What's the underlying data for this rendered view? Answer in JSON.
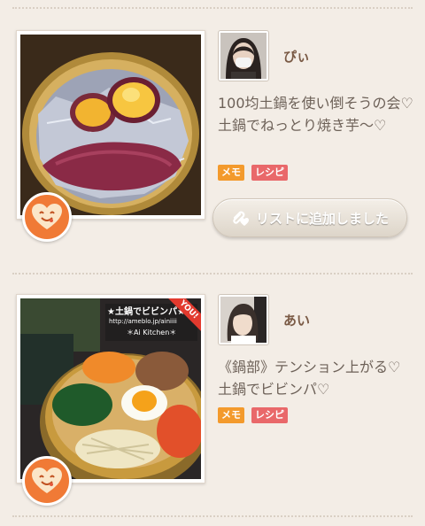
{
  "posts": [
    {
      "username": "ぴぃ",
      "title": "100均土鍋を使い倒そうの会♡土鍋でねっとり焼き芋〜♡",
      "tags": {
        "memo": "メモ",
        "recipe": "レシピ"
      },
      "list_button_label": "リストに追加しました",
      "photo_icon": "roasted-sweet-potato-photo",
      "avatar_icon": "masked-woman-avatar"
    },
    {
      "username": "あい",
      "title": "《鍋部》テンション上がる♡土鍋でビビンパ♡",
      "tags": {
        "memo": "メモ",
        "recipe": "レシピ"
      },
      "photo_icon": "bibimbap-photo",
      "photo_overlay_text": "★土鍋でビビンパ★",
      "photo_overlay_url": "http://ameblo.jp/ainiiii",
      "photo_overlay_sub": "＊Ai Kitchen＊",
      "ribbon_label": "YOU!",
      "avatar_icon": "woman-bob-avatar"
    }
  ],
  "colors": {
    "background": "#f3ede6",
    "heart_badge": "#f07a36",
    "tag_memo": "#f39a2c",
    "tag_recipe": "#e9686a"
  }
}
